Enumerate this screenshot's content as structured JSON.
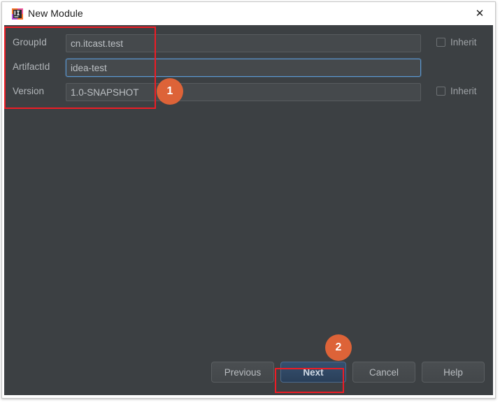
{
  "window": {
    "title": "New Module",
    "icon": "intellij-idea-icon",
    "close_label": "✕"
  },
  "form": {
    "rows": [
      {
        "label": "GroupId",
        "value": "cn.itcast.test",
        "placeholder": "",
        "focused": false,
        "inherit": {
          "label": "Inherit",
          "checked": false,
          "visible": true
        }
      },
      {
        "label": "ArtifactId",
        "value": "idea-test",
        "placeholder": "",
        "focused": true,
        "inherit": {
          "label": "",
          "checked": false,
          "visible": false
        }
      },
      {
        "label": "Version",
        "value": "1.0-SNAPSHOT",
        "placeholder": "",
        "focused": false,
        "inherit": {
          "label": "Inherit",
          "checked": false,
          "visible": true
        }
      }
    ]
  },
  "buttons": {
    "previous": "Previous",
    "next": "Next",
    "cancel": "Cancel",
    "help": "Help"
  },
  "annotations": {
    "badge_1": "1",
    "badge_2": "2",
    "highlight_color": "#ee1c25",
    "badge_color": "#dd6338"
  },
  "colors": {
    "dialog_background": "#3c4043",
    "titlebar_background": "#ffffff",
    "input_background": "#45494c",
    "focus_border": "#5b97d1",
    "default_button": "#2f4662",
    "label_text": "#b2b6ba"
  }
}
